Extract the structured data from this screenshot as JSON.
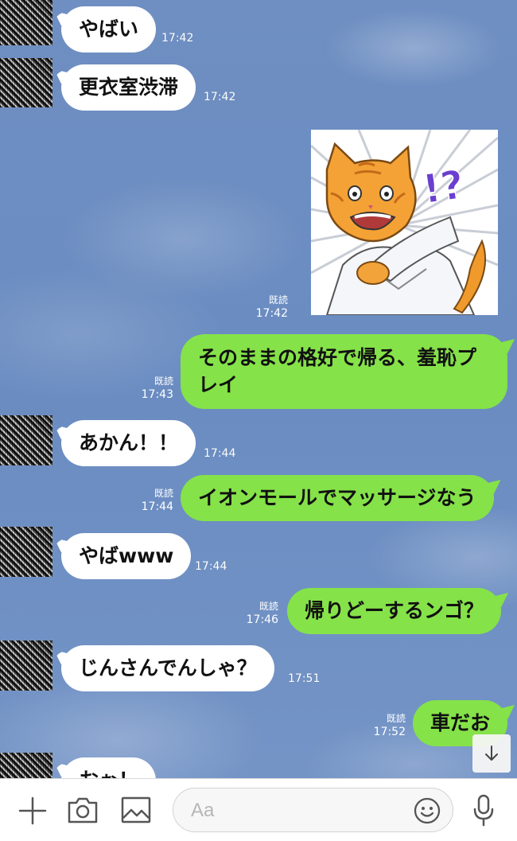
{
  "messages": [
    {
      "text": "やばい",
      "time": "17:42"
    },
    {
      "text": "更衣室渋滞",
      "time": "17:42"
    },
    {
      "read": "既読",
      "time": "17:42"
    },
    {
      "text": "そのままの格好で帰る、羞恥プレイ",
      "read": "既読",
      "time": "17:43"
    },
    {
      "text": "あかん！！",
      "time": "17:44"
    },
    {
      "text": "イオンモールでマッサージなう",
      "read": "既読",
      "time": "17:44"
    },
    {
      "text": "やばwww",
      "time": "17:44"
    },
    {
      "text": "帰りどーするンゴ？",
      "read": "既読",
      "time": "17:46"
    },
    {
      "text": "じんさんでんしゃ？",
      "time": "17:51"
    },
    {
      "text": "車だお",
      "read": "既読",
      "time": "17:52"
    },
    {
      "text": "おぉ！"
    }
  ],
  "sticker": {
    "exclaim": "!?"
  },
  "input": {
    "placeholder": "Aa"
  },
  "colors": {
    "incoming": "#ffffff",
    "outgoing": "#85e249",
    "background": "#6b8cbf"
  }
}
